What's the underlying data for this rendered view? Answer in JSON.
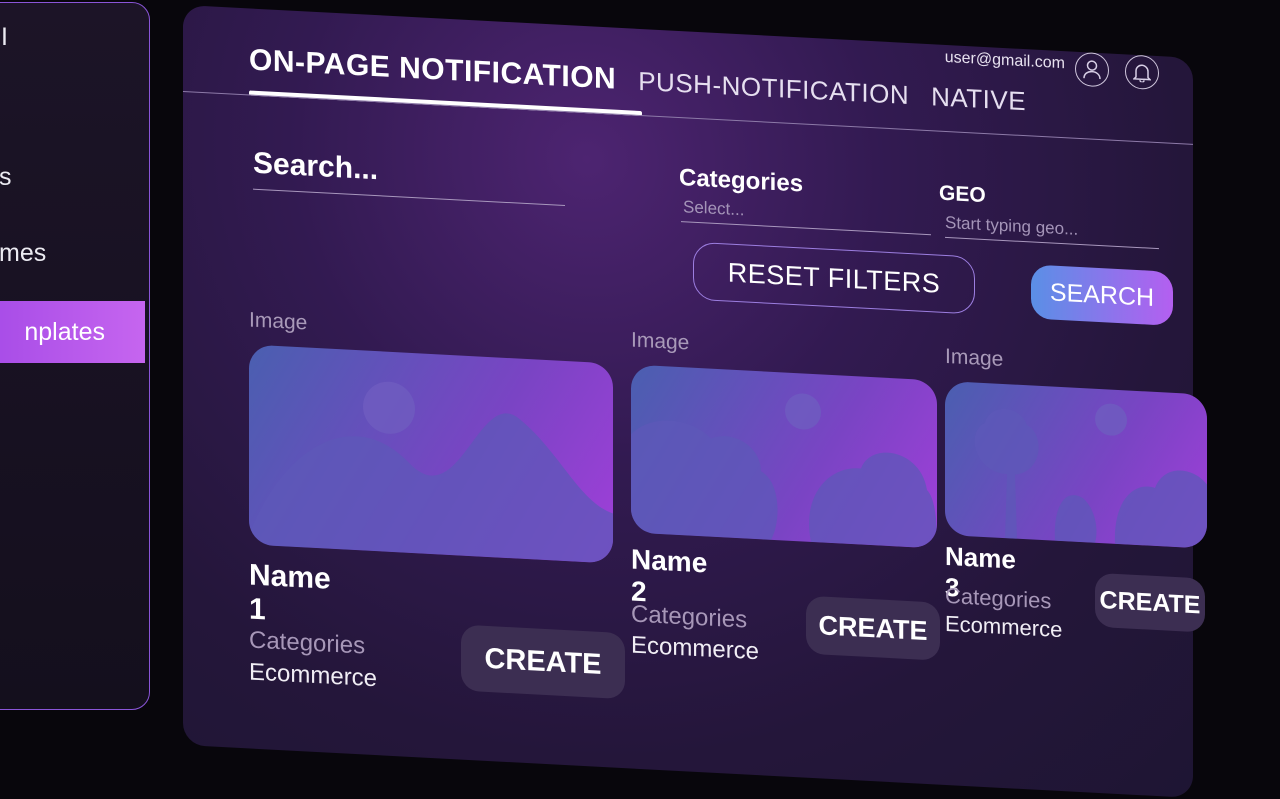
{
  "sidebar": {
    "items": [
      {
        "label": "I"
      },
      {
        "label": "s"
      },
      {
        "label": "mes"
      },
      {
        "label": "nplates",
        "active": true
      }
    ]
  },
  "header": {
    "user_email": "user@gmail.com",
    "icons": [
      "user-icon",
      "bell-icon"
    ]
  },
  "tabs": [
    {
      "label": "ON-PAGE NOTIFICATION",
      "active": true
    },
    {
      "label": "PUSH-NOTIFICATION"
    },
    {
      "label": "NATIVE"
    }
  ],
  "filters": {
    "search_placeholder": "Search...",
    "categories_label": "Categories",
    "categories_placeholder": "Select...",
    "geo_label": "GEO",
    "geo_placeholder": "Start typing geo...",
    "reset_label": "RESET FILTERS",
    "search_button": "SEARCH"
  },
  "cards": [
    {
      "image_label": "Image",
      "name": "Name 1",
      "categories_label": "Categories",
      "category": "Ecommerce",
      "create_label": "CREATE"
    },
    {
      "image_label": "Image",
      "name": "Name 2",
      "categories_label": "Categories",
      "category": "Ecommerce",
      "create_label": "CREATE"
    },
    {
      "image_label": "Image",
      "name": "Name 3",
      "categories_label": "Categories",
      "category": "Ecommerce",
      "create_label": "CREATE"
    }
  ],
  "colors": {
    "accent": "#b45ff0",
    "active_item": "#a349e6",
    "panel_bg": "#2a1a42"
  }
}
